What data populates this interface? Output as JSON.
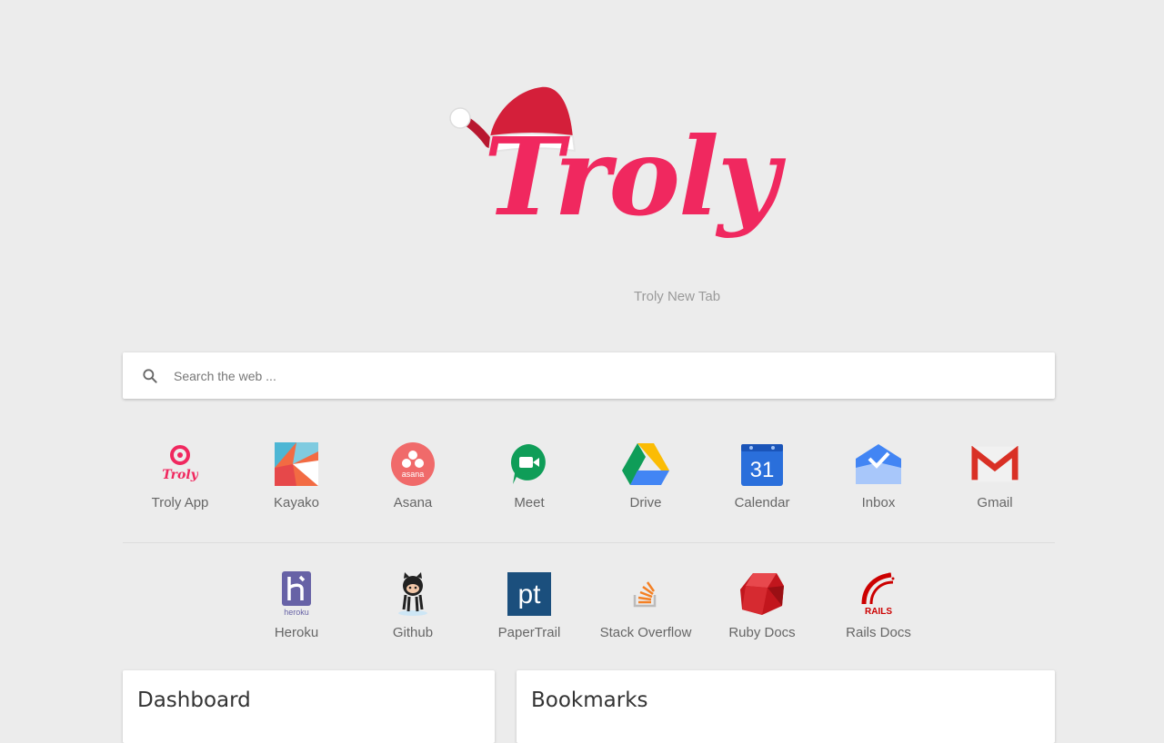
{
  "logo": {
    "text": "Troly",
    "brand_color": "#f0285f",
    "hat_color": "#d41f3a"
  },
  "subtitle": "Troly New Tab",
  "search": {
    "placeholder": "Search the web ...",
    "value": ""
  },
  "apps_row1": [
    {
      "label": "Troly App",
      "icon": "troly-app-icon"
    },
    {
      "label": "Kayako",
      "icon": "kayako-icon"
    },
    {
      "label": "Asana",
      "icon": "asana-icon"
    },
    {
      "label": "Meet",
      "icon": "meet-icon"
    },
    {
      "label": "Drive",
      "icon": "drive-icon"
    },
    {
      "label": "Calendar",
      "icon": "calendar-icon",
      "icon_text": "31"
    },
    {
      "label": "Inbox",
      "icon": "inbox-icon"
    },
    {
      "label": "Gmail",
      "icon": "gmail-icon"
    }
  ],
  "apps_row2": [
    {
      "label": "Heroku",
      "icon": "heroku-icon",
      "icon_text": "heroku"
    },
    {
      "label": "Github",
      "icon": "github-icon"
    },
    {
      "label": "PaperTrail",
      "icon": "papertrail-icon",
      "icon_text": "pt"
    },
    {
      "label": "Stack Overflow",
      "icon": "stackoverflow-icon"
    },
    {
      "label": "Ruby Docs",
      "icon": "ruby-icon"
    },
    {
      "label": "Rails Docs",
      "icon": "rails-icon",
      "icon_text": "RAILS"
    }
  ],
  "cards": {
    "dashboard_title": "Dashboard",
    "bookmarks_title": "Bookmarks"
  },
  "colors": {
    "background": "#ececec",
    "card": "#ffffff"
  }
}
